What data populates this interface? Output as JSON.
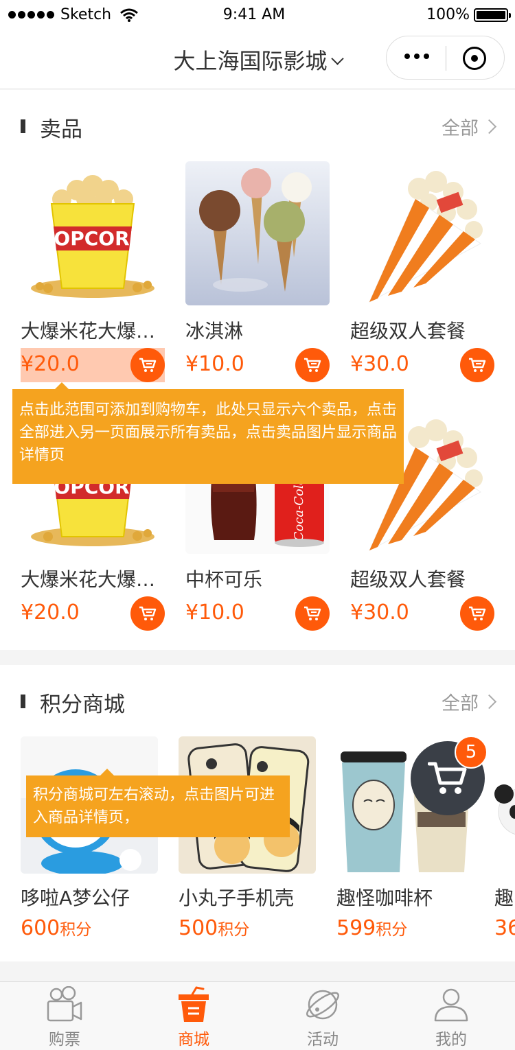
{
  "status_bar": {
    "carrier": "Sketch",
    "time": "9:41 AM",
    "battery": "100%"
  },
  "nav": {
    "title": "大上海国际影城"
  },
  "snacks": {
    "title": "卖品",
    "all_label": "全部",
    "items": [
      {
        "name": "大爆米花大爆米花",
        "price": "¥20.0",
        "image": "popcorn-bucket"
      },
      {
        "name": "冰淇淋",
        "price": "¥10.0",
        "image": "ice-cream"
      },
      {
        "name": "超级双人套餐",
        "price": "¥30.0",
        "image": "popcorn-cone"
      },
      {
        "name": "大爆米花大爆米花",
        "price": "¥20.0",
        "image": "popcorn-bucket"
      },
      {
        "name": "中杯可乐",
        "price": "¥10.0",
        "image": "cola"
      },
      {
        "name": "超级双人套餐",
        "price": "¥30.0",
        "image": "popcorn-cone"
      }
    ],
    "tooltip": "点击此范围可添加到购物车，此处只显示六个卖品，点击全部进入另一页面展示所有卖品，点击卖品图片显示商品详情页"
  },
  "points_mall": {
    "title": "积分商城",
    "all_label": "全部",
    "items": [
      {
        "name": "哆啦A梦公仔",
        "points": "600",
        "unit": "积分",
        "image": "doraemon-plush"
      },
      {
        "name": "小丸子手机壳",
        "points": "500",
        "unit": "积分",
        "image": "phone-case"
      },
      {
        "name": "趣怪咖啡杯",
        "points": "599",
        "unit": "积分",
        "image": "coffee-cup"
      },
      {
        "name": "趣",
        "points": "36",
        "unit": "",
        "image": "panda"
      }
    ],
    "tooltip": "积分商城可左右滚动，点击图片可进入商品详情页，"
  },
  "floating_cart": {
    "count": "5"
  },
  "tab_bar": {
    "items": [
      {
        "label": "购票",
        "icon": "camera-icon"
      },
      {
        "label": "商城",
        "icon": "cup-icon"
      },
      {
        "label": "活动",
        "icon": "planet-icon"
      },
      {
        "label": "我的",
        "icon": "user-icon"
      }
    ],
    "active_index": 1
  },
  "colors": {
    "accent": "#ff5a0a",
    "tooltip": "#f5a31f",
    "highlight": "#ffc9b0",
    "cart_dark": "#3a3f47"
  }
}
